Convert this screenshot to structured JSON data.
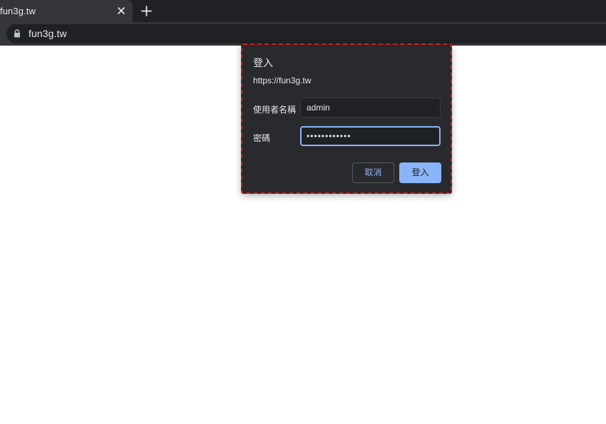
{
  "browser": {
    "tab": {
      "title": "fun3g.tw"
    },
    "omnibox": {
      "url": "fun3g.tw"
    }
  },
  "dialog": {
    "title": "登入",
    "origin": "https://fun3g.tw",
    "username": {
      "label": "使用者名稱",
      "value": "admin"
    },
    "password": {
      "label": "密碼",
      "masked_value": "••••••••••••"
    },
    "buttons": {
      "cancel": "取消",
      "login": "登入"
    }
  },
  "colors": {
    "tabstrip": "#202124",
    "toolbar": "#35363a",
    "dialog_bg": "#292a2d",
    "accent": "#8ab4f8",
    "highlight_border": "#d61a22"
  },
  "icons": {
    "tab_close": "close-icon",
    "new_tab": "plus-icon",
    "site_security": "lock-icon"
  }
}
